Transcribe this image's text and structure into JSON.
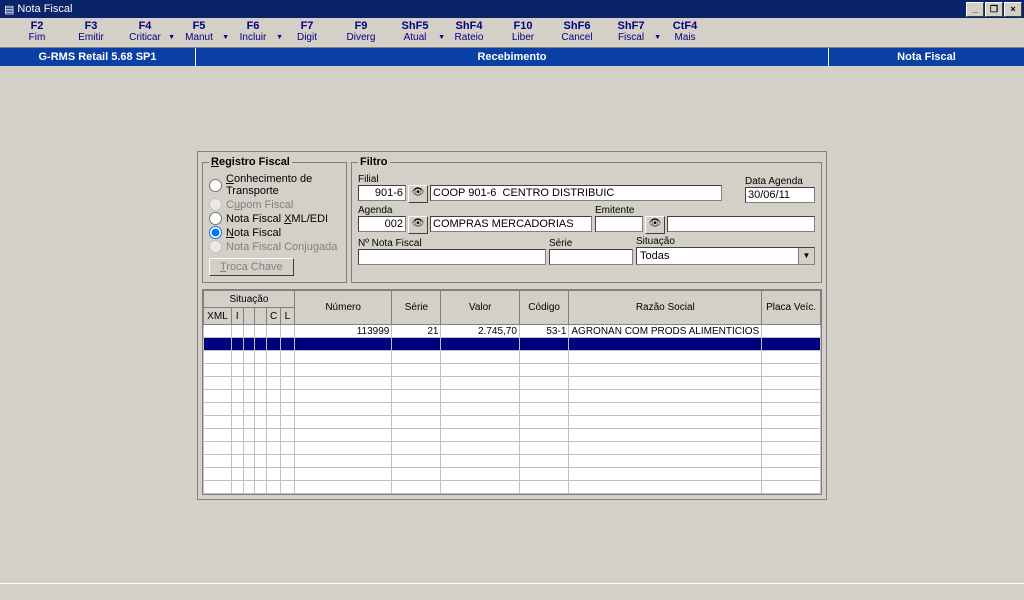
{
  "title": "Nota Fiscal",
  "toolbar": [
    {
      "key": "F2",
      "label": "Fim",
      "drop": false
    },
    {
      "key": "F3",
      "label": "Emitir",
      "drop": false
    },
    {
      "key": "F4",
      "label": "Criticar",
      "drop": true
    },
    {
      "key": "F5",
      "label": "Manut",
      "drop": true
    },
    {
      "key": "F6",
      "label": "Incluir",
      "drop": true
    },
    {
      "key": "F7",
      "label": "Digit",
      "drop": false
    },
    {
      "key": "F9",
      "label": "Diverg",
      "drop": false
    },
    {
      "key": "ShF5",
      "label": "Atual",
      "drop": true
    },
    {
      "key": "ShF4",
      "label": "Rateio",
      "drop": false
    },
    {
      "key": "F10",
      "label": "Liber",
      "drop": false
    },
    {
      "key": "ShF6",
      "label": "Cancel",
      "drop": false
    },
    {
      "key": "ShF7",
      "label": "Fiscal",
      "drop": true
    },
    {
      "key": "CtF4",
      "label": "Mais",
      "drop": false
    }
  ],
  "bluebar": {
    "left": "G-RMS Retail 5.68 SP1",
    "center": "Recebimento",
    "right": "Nota Fiscal"
  },
  "registro": {
    "legend": "Registro Fiscal",
    "options": [
      {
        "label": "Conhecimento de Transporte",
        "checked": false,
        "enabled": true,
        "u": "C"
      },
      {
        "label": "Cupom Fiscal",
        "checked": false,
        "enabled": false,
        "u": "u"
      },
      {
        "label": "Nota Fiscal XML/EDI",
        "checked": false,
        "enabled": true,
        "u": "X"
      },
      {
        "label": "Nota Fiscal",
        "checked": true,
        "enabled": true,
        "u": "N"
      },
      {
        "label": "Nota Fiscal Conjugada",
        "checked": false,
        "enabled": false,
        "u": "j"
      }
    ],
    "button": "Troca Chave"
  },
  "filtro": {
    "legend": "Filtro",
    "filial": {
      "label": "Filial",
      "code": "901-6",
      "desc": "COOP 901-6  CENTRO DISTRIBUIC"
    },
    "dataagenda": {
      "label": "Data Agenda",
      "value": "30/06/11"
    },
    "agenda": {
      "label": "Agenda",
      "code": "002",
      "desc": "COMPRAS MERCADORIAS"
    },
    "emitente": {
      "label": "Emitente",
      "code": "",
      "desc": ""
    },
    "numnota": {
      "label": "Nº Nota Fiscal",
      "value": ""
    },
    "serie": {
      "label": "Série",
      "value": ""
    },
    "situacao": {
      "label": "Situação",
      "value": "Todas"
    }
  },
  "grid": {
    "headers": {
      "topSituacao": "Situação",
      "xml": "XML",
      "i": "I",
      "blank1": "",
      "blank2": "",
      "c": "C",
      "l": "L",
      "numero": "Número",
      "serie": "Série",
      "valor": "Valor",
      "codigo": "Código",
      "razao": "Razão Social",
      "placa": "Placa Veíc."
    },
    "row": {
      "xml": "",
      "i": "",
      "b1": "",
      "b2": "",
      "c": "",
      "l": "",
      "numero": "113999",
      "serie": "21",
      "valor": "2.745,70",
      "codigo": "53-1",
      "razao": "AGRONAN COM PRODS ALIMENTICIOS",
      "placa": ""
    }
  }
}
